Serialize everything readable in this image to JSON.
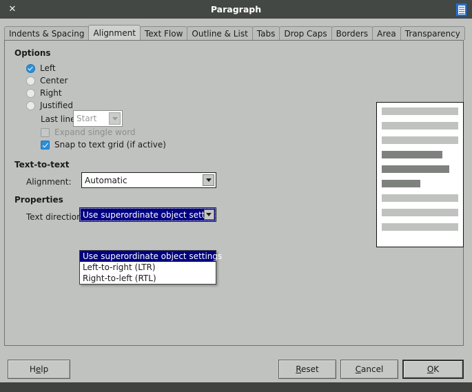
{
  "window": {
    "title": "Paragraph",
    "close_label": "✕",
    "app_icon": "writer-document-icon"
  },
  "tabs": [
    {
      "label": "Indents & Spacing",
      "active": false
    },
    {
      "label": "Alignment",
      "active": true
    },
    {
      "label": "Text Flow",
      "active": false
    },
    {
      "label": "Outline & List",
      "active": false
    },
    {
      "label": "Tabs",
      "active": false
    },
    {
      "label": "Drop Caps",
      "active": false
    },
    {
      "label": "Borders",
      "active": false
    },
    {
      "label": "Area",
      "active": false
    },
    {
      "label": "Transparency",
      "active": false
    }
  ],
  "options": {
    "heading": "Options",
    "radios": [
      {
        "label": "Left",
        "checked": true
      },
      {
        "label": "Center",
        "checked": false
      },
      {
        "label": "Right",
        "checked": false
      },
      {
        "label": "Justified",
        "checked": false
      }
    ],
    "last_line": {
      "label": "Last line:",
      "value": "Start",
      "disabled": true
    },
    "checkboxes": [
      {
        "label": "Expand single word",
        "checked": false,
        "disabled": true
      },
      {
        "label": "Snap to text grid (if active)",
        "checked": true,
        "disabled": false
      }
    ]
  },
  "text_to_text": {
    "heading": "Text-to-text",
    "alignment": {
      "label": "Alignment:",
      "value": "Automatic"
    }
  },
  "properties": {
    "heading": "Properties",
    "text_direction": {
      "label": "Text direction:",
      "value": "Use superordinate object settings",
      "open": true,
      "options": [
        {
          "label": "Use superordinate object settings",
          "selected": true
        },
        {
          "label": "Left-to-right (LTR)",
          "selected": false
        },
        {
          "label": "Right-to-left (RTL)",
          "selected": false
        }
      ]
    }
  },
  "preview": {
    "name": "paragraph-alignment-preview",
    "lines": [
      {
        "tone": "light",
        "width_pct": 100
      },
      {
        "tone": "light",
        "width_pct": 100
      },
      {
        "tone": "light",
        "width_pct": 100
      },
      {
        "tone": "dark",
        "width_pct": 79
      },
      {
        "tone": "dark",
        "width_pct": 88
      },
      {
        "tone": "dark",
        "width_pct": 50
      },
      {
        "tone": "light",
        "width_pct": 100
      },
      {
        "tone": "light",
        "width_pct": 100
      },
      {
        "tone": "light",
        "width_pct": 100
      }
    ]
  },
  "buttons": {
    "help": {
      "label": "Help",
      "mnemonic": "e"
    },
    "reset": {
      "label": "Reset",
      "mnemonic": "R"
    },
    "cancel": {
      "label": "Cancel",
      "mnemonic": "C"
    },
    "ok": {
      "label": "OK",
      "mnemonic": "O",
      "default": true
    }
  },
  "colors": {
    "dialog_bg": "#c0c2c0",
    "titlebar_bg": "#444845",
    "accent_blue": "#2a8fd8",
    "selection_navy": "#000080",
    "preview_light": "#c0c2c0",
    "preview_dark": "#7f817f"
  }
}
